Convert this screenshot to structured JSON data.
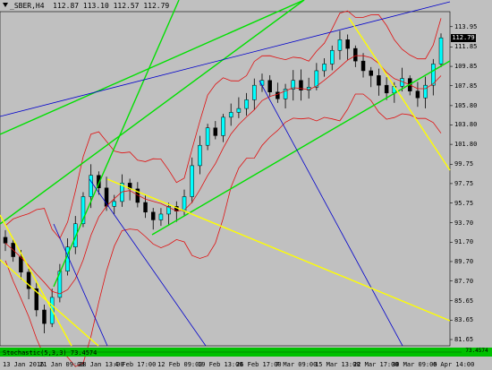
{
  "header": {
    "symbol": "_SBER,H4",
    "ohlc": "112.87 113.10 112.57 112.79"
  },
  "price_axis": {
    "ticks": [
      "113.95",
      "111.85",
      "109.85",
      "107.85",
      "105.80",
      "103.80",
      "101.80",
      "99.75",
      "97.75",
      "95.75",
      "93.70",
      "91.70",
      "89.70",
      "87.70",
      "85.65",
      "83.65",
      "81.65"
    ],
    "current_price": "112.79"
  },
  "time_axis": {
    "ticks": [
      "13 Jan 2016",
      "21 Jan 09:00",
      "28 Jan 13:00",
      "4 Feb 17:00",
      "12 Feb 09:00",
      "19 Feb 13:00",
      "26 Feb 17:00",
      "7 Mar 09:00",
      "15 Mar 13:00",
      "22 Mar 17:00",
      "30 Mar 09:00",
      "6 Apr 14:00"
    ]
  },
  "indicator": {
    "label": "Stochastic(5,3,3) 73.4574",
    "value": "73.4574"
  },
  "colors": {
    "background": "#c0c0c0",
    "bollinger": "#e01010",
    "fan_lines": "#00e000",
    "trend_blue": "#0000cc",
    "yellow_lines": "#ffff00",
    "candle_up": "#00ffff",
    "candle_down": "#000000"
  },
  "chart_data": {
    "type": "candlestick",
    "title": "_SBER,H4",
    "ylim": [
      81.0,
      115.5
    ],
    "x_categories": [
      "13 Jan 2016",
      "21 Jan 09:00",
      "28 Jan 13:00",
      "4 Feb 17:00",
      "12 Feb 09:00",
      "19 Feb 13:00",
      "26 Feb 17:00",
      "7 Mar 09:00",
      "15 Mar 13:00",
      "22 Mar 17:00",
      "30 Mar 09:00",
      "6 Apr 14:00"
    ],
    "close_path": [
      91.6,
      90.2,
      88.6,
      86.9,
      84.7,
      83.3,
      86.0,
      88.7,
      91.2,
      93.6,
      96.4,
      98.6,
      97.3,
      95.4,
      95.9,
      97.8,
      97.2,
      95.8,
      94.8,
      94.0,
      94.6,
      95.4,
      94.9,
      96.4,
      99.6,
      101.7,
      103.5,
      102.7,
      104.6,
      105.1,
      105.5,
      106.4,
      107.9,
      108.4,
      107.2,
      106.5,
      107.5,
      108.4,
      107.4,
      107.7,
      109.4,
      110.1,
      111.5,
      112.6,
      111.7,
      110.4,
      109.4,
      108.9,
      107.9,
      107.1,
      107.8,
      108.6,
      107.3,
      106.6,
      107.9,
      110.1,
      112.8
    ],
    "last_ohlc": {
      "open": 112.87,
      "high": 113.1,
      "low": 112.57,
      "close": 112.79
    },
    "indicator": {
      "name": "Stochastic(5,3,3)",
      "value": 73.4574
    }
  }
}
